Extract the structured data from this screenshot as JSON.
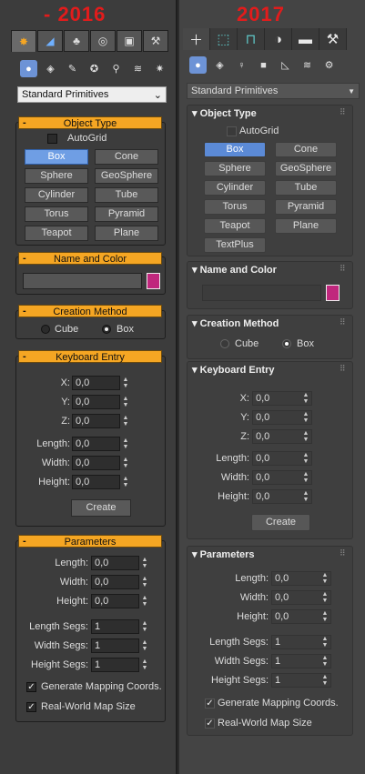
{
  "left": {
    "year": "- 2016",
    "tabs": [
      "create",
      "modify",
      "hierarchy",
      "motion",
      "display",
      "utilities"
    ],
    "icons": [
      "geometry-icon",
      "shapes-icon",
      "lights-icon",
      "cameras-icon",
      "helpers-icon",
      "spacewarps-icon",
      "systems-icon"
    ],
    "dropdown": "Standard Primitives",
    "object_type": {
      "title": "Object Type",
      "autogrid": "AutoGrid",
      "buttons": [
        "Box",
        "Cone",
        "Sphere",
        "GeoSphere",
        "Cylinder",
        "Tube",
        "Torus",
        "Pyramid",
        "Teapot",
        "Plane"
      ]
    },
    "name_color": {
      "title": "Name and Color"
    },
    "creation": {
      "title": "Creation Method",
      "cube": "Cube",
      "box": "Box"
    },
    "keyboard": {
      "title": "Keyboard Entry",
      "x": "X:",
      "y": "Y:",
      "z": "Z:",
      "length": "Length:",
      "width": "Width:",
      "height": "Height:",
      "xv": "0,0",
      "yv": "0,0",
      "zv": "0,0",
      "lv": "0,0",
      "wv": "0,0",
      "hv": "0,0",
      "create": "Create"
    },
    "params": {
      "title": "Parameters",
      "length": "Length:",
      "width": "Width:",
      "height": "Height:",
      "lv": "0,0",
      "wv": "0,0",
      "hv": "0,0",
      "lsegs": "Length Segs:",
      "wsegs": "Width Segs:",
      "hsegs": "Height Segs:",
      "lsv": "1",
      "wsv": "1",
      "hsv": "1",
      "genmap": "Generate Mapping Coords.",
      "realworld": "Real-World Map Size"
    }
  },
  "right": {
    "year": "2017",
    "dropdown": "Standard Primitives",
    "object_type": {
      "title": "Object Type",
      "autogrid": "AutoGrid",
      "buttons": [
        "Box",
        "Cone",
        "Sphere",
        "GeoSphere",
        "Cylinder",
        "Tube",
        "Torus",
        "Pyramid",
        "Teapot",
        "Plane",
        "TextPlus"
      ]
    },
    "name_color": {
      "title": "Name and Color"
    },
    "creation": {
      "title": "Creation Method",
      "cube": "Cube",
      "box": "Box"
    },
    "keyboard": {
      "title": "Keyboard Entry",
      "x": "X:",
      "y": "Y:",
      "z": "Z:",
      "length": "Length:",
      "width": "Width:",
      "height": "Height:",
      "xv": "0,0",
      "yv": "0,0",
      "zv": "0,0",
      "lv": "0,0",
      "wv": "0,0",
      "hv": "0,0",
      "create": "Create"
    },
    "params": {
      "title": "Parameters",
      "length": "Length:",
      "width": "Width:",
      "height": "Height:",
      "lv": "0,0",
      "wv": "0,0",
      "hv": "0,0",
      "lsegs": "Length Segs:",
      "wsegs": "Width Segs:",
      "hsegs": "Height Segs:",
      "lsv": "1",
      "wsv": "1",
      "hsv": "1",
      "genmap": "Generate Mapping Coords.",
      "realworld": "Real-World Map Size"
    }
  },
  "colors": {
    "accent_2016": "#f5a623",
    "object_color": "#c0277d",
    "selected": "#6f9ee4",
    "year": "#e21c1c"
  }
}
